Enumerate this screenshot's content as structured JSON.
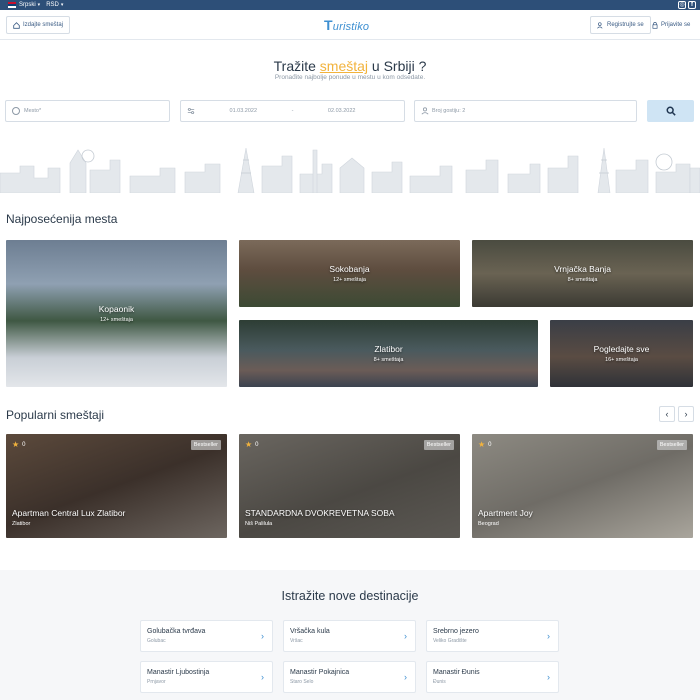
{
  "topbar": {
    "language": "Srpski",
    "currency": "RSD",
    "social": [
      "instagram-icon",
      "facebook-icon"
    ]
  },
  "header": {
    "list_button": "Izdajte smeštaj",
    "logo": "uristiko",
    "logo_initial": "T",
    "register": "Registrujte se",
    "login": "Prijavite se"
  },
  "hero": {
    "title_before": "Tražite ",
    "title_highlight": "smeštaj",
    "title_after": " u Srbiji ?",
    "subtitle": "Pronađite najbolje ponude u mestu u kom odsedate."
  },
  "search": {
    "place_placeholder": "Mesto*",
    "date_from": "01.03.2022",
    "date_sep": "-",
    "date_to": "02.03.2022",
    "guests": "Broj gostiju: 2"
  },
  "places": {
    "title": "Najposećenija mesta",
    "items": [
      {
        "name": "Kopaonik",
        "count": "12+ smeštaja"
      },
      {
        "name": "Sokobanja",
        "count": "12+ smeštaja"
      },
      {
        "name": "Vrnjačka Banja",
        "count": "8+ smeštaja"
      },
      {
        "name": "Zlatibor",
        "count": "8+ smeštaja"
      },
      {
        "name": "Pogledajte sve",
        "count": "16+ smeštaja"
      }
    ]
  },
  "popular": {
    "title": "Popularni smeštaji",
    "items": [
      {
        "rating": "0",
        "badge": "Bestseller",
        "title": "Apartman Central Lux Zlatibor",
        "location": "Zlatibor"
      },
      {
        "rating": "0",
        "badge": "Bestseller",
        "title": "STANDARDNA DVOKREVETNA SOBA",
        "location": "Niš Palilula"
      },
      {
        "rating": "0",
        "badge": "Bestseller",
        "title": "Apartment Joy",
        "location": "Beograd"
      }
    ]
  },
  "destinations": {
    "title": "Istražite nove destinacije",
    "items": [
      {
        "name": "Golubačka tvrđava",
        "sub": "Golubac"
      },
      {
        "name": "Vršačka kula",
        "sub": "Vršac"
      },
      {
        "name": "Srebrno jezero",
        "sub": "Veliko Gradište"
      },
      {
        "name": "Manastir Ljubostinja",
        "sub": "Prnjavor"
      },
      {
        "name": "Manastir Pokajnica",
        "sub": "Staro Selo"
      },
      {
        "name": "Manastir Đunis",
        "sub": "Đunis"
      }
    ]
  }
}
